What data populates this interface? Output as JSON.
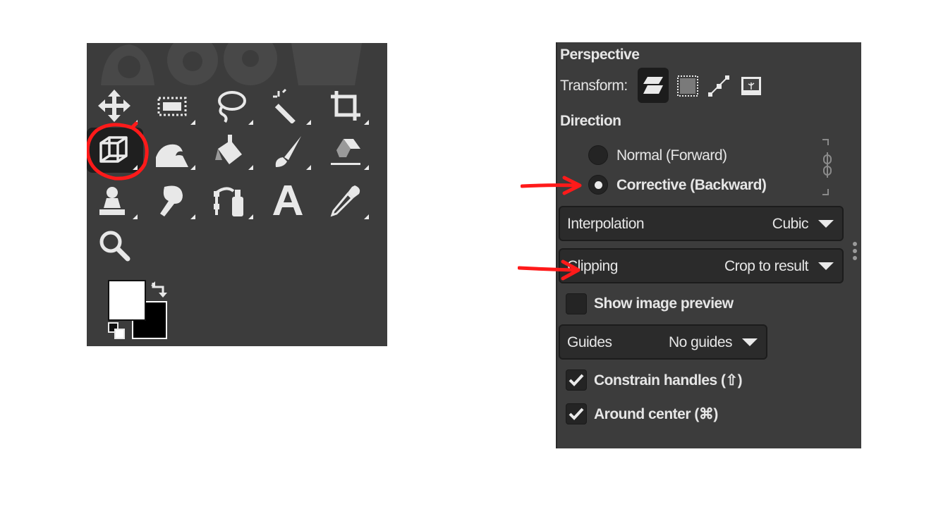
{
  "toolbox": {
    "tools": [
      {
        "name": "move-tool",
        "icon": "move-icon"
      },
      {
        "name": "rect-select-tool",
        "icon": "rect-select-icon"
      },
      {
        "name": "free-select-tool",
        "icon": "lasso-icon"
      },
      {
        "name": "fuzzy-select-tool",
        "icon": "magic-wand-icon"
      },
      {
        "name": "crop-tool",
        "icon": "crop-icon"
      },
      {
        "name": "perspective-tool",
        "icon": "perspective-icon",
        "active": true
      },
      {
        "name": "warp-tool",
        "icon": "wave-icon"
      },
      {
        "name": "bucket-fill-tool",
        "icon": "bucket-icon"
      },
      {
        "name": "paintbrush-tool",
        "icon": "paintbrush-icon"
      },
      {
        "name": "eraser-tool",
        "icon": "eraser-icon"
      },
      {
        "name": "clone-tool",
        "icon": "stamp-icon"
      },
      {
        "name": "smudge-tool",
        "icon": "smudge-icon"
      },
      {
        "name": "paths-tool",
        "icon": "paths-icon"
      },
      {
        "name": "text-tool",
        "icon": "text-icon",
        "glyph": "A"
      },
      {
        "name": "color-picker-tool",
        "icon": "eyedropper-icon"
      },
      {
        "name": "zoom-tool",
        "icon": "magnifier-icon"
      }
    ],
    "foreground_color": "#ffffff",
    "background_color": "#000000"
  },
  "options": {
    "title": "Perspective",
    "transform_label": "Transform:",
    "transform_modes": [
      {
        "icon": "layer-mode-icon",
        "active": true
      },
      {
        "icon": "selection-mode-icon"
      },
      {
        "icon": "path-mode-icon"
      },
      {
        "icon": "image-mode-icon"
      }
    ],
    "direction_label": "Direction",
    "direction_options": [
      "Normal (Forward)",
      "Corrective (Backward)"
    ],
    "direction_selected": "Corrective (Backward)",
    "interpolation": {
      "label": "Interpolation",
      "value": "Cubic"
    },
    "clipping": {
      "label": "Clipping",
      "value": "Crop to result"
    },
    "show_preview": {
      "label": "Show image preview",
      "checked": false
    },
    "guides": {
      "label": "Guides",
      "value": "No guides"
    },
    "constrain": {
      "label": "Constrain handles (⇧)",
      "checked": true
    },
    "around_center": {
      "label": "Around center (⌘)",
      "checked": true
    }
  },
  "colors": {
    "panel_bg": "#3c3c3c",
    "annotation_red": "#ff0000"
  }
}
